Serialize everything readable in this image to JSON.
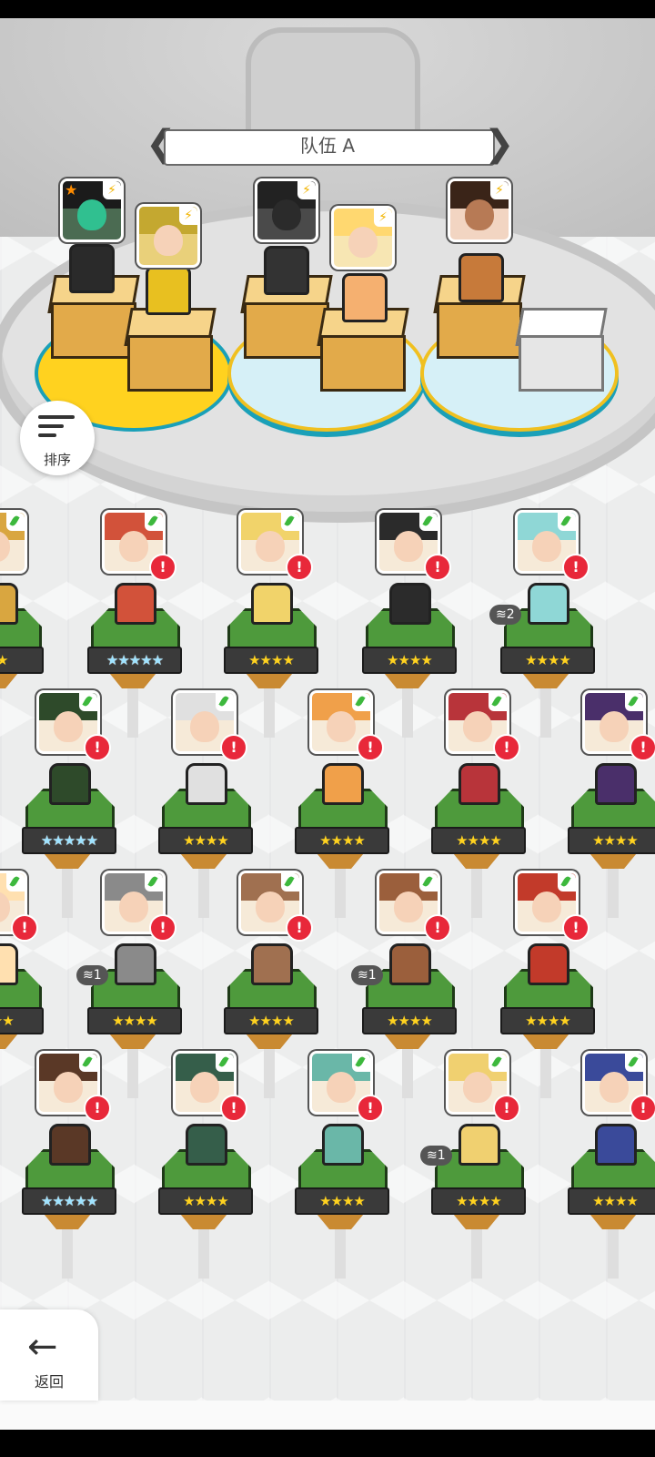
{
  "team": {
    "title": "队伍 A"
  },
  "sort": {
    "label": "排序"
  },
  "back": {
    "label": "返回"
  },
  "roster": {
    "rows": [
      [
        {
          "stars": "★★",
          "alert": false
        },
        {
          "stars": "★★★★★",
          "alert": true
        },
        {
          "stars": "★★★★",
          "alert": true
        },
        {
          "stars": "★★★★",
          "alert": true
        },
        {
          "stars": "★★★★",
          "alert": true,
          "dup": "2"
        }
      ],
      [
        {
          "stars": "★★★★★",
          "alert": true
        },
        {
          "stars": "★★★★",
          "alert": true
        },
        {
          "stars": "★★★★",
          "alert": true
        },
        {
          "stars": "★★★★",
          "alert": true
        },
        {
          "stars": "★★★★",
          "alert": true
        }
      ],
      [
        {
          "stars": "★★★",
          "alert": true
        },
        {
          "stars": "★★★★",
          "alert": true,
          "dup": "1"
        },
        {
          "stars": "★★★★",
          "alert": true
        },
        {
          "stars": "★★★★",
          "alert": true,
          "dup": "1"
        },
        {
          "stars": "★★★★",
          "alert": true
        }
      ],
      [
        {
          "stars": "★★★★★",
          "alert": true
        },
        {
          "stars": "★★★★",
          "alert": true
        },
        {
          "stars": "★★★★",
          "alert": true
        },
        {
          "stars": "★★★★",
          "alert": true,
          "dup": "1"
        },
        {
          "stars": "★★★★",
          "alert": true
        }
      ]
    ]
  },
  "badges": {
    "alert_mark": "!",
    "dup_prefix": "≋"
  }
}
